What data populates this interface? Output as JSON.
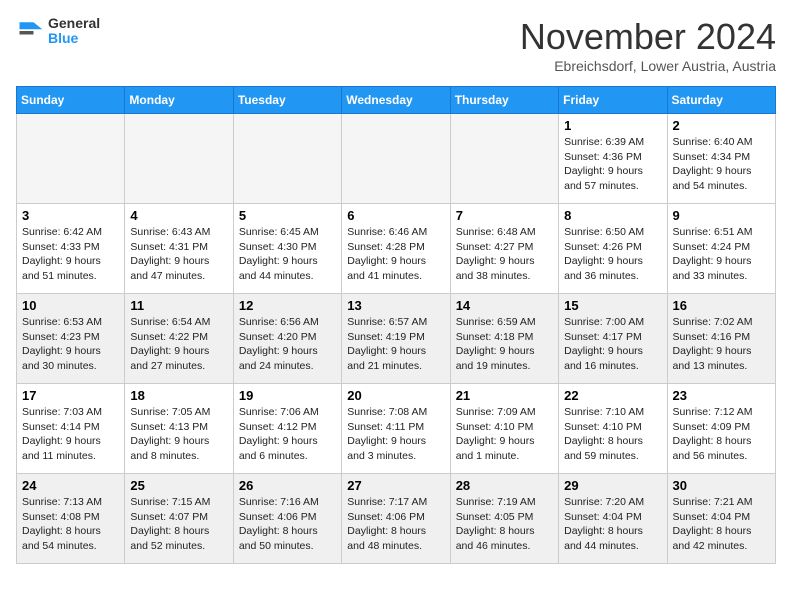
{
  "logo": {
    "line1": "General",
    "line2": "Blue"
  },
  "title": "November 2024",
  "subtitle": "Ebreichsdorf, Lower Austria, Austria",
  "weekdays": [
    "Sunday",
    "Monday",
    "Tuesday",
    "Wednesday",
    "Thursday",
    "Friday",
    "Saturday"
  ],
  "weeks": [
    [
      {
        "day": "",
        "empty": true
      },
      {
        "day": "",
        "empty": true
      },
      {
        "day": "",
        "empty": true
      },
      {
        "day": "",
        "empty": true
      },
      {
        "day": "",
        "empty": true
      },
      {
        "day": "1",
        "sunrise": "6:39 AM",
        "sunset": "4:36 PM",
        "daylight": "9 hours and 57 minutes."
      },
      {
        "day": "2",
        "sunrise": "6:40 AM",
        "sunset": "4:34 PM",
        "daylight": "9 hours and 54 minutes."
      }
    ],
    [
      {
        "day": "3",
        "sunrise": "6:42 AM",
        "sunset": "4:33 PM",
        "daylight": "9 hours and 51 minutes."
      },
      {
        "day": "4",
        "sunrise": "6:43 AM",
        "sunset": "4:31 PM",
        "daylight": "9 hours and 47 minutes."
      },
      {
        "day": "5",
        "sunrise": "6:45 AM",
        "sunset": "4:30 PM",
        "daylight": "9 hours and 44 minutes."
      },
      {
        "day": "6",
        "sunrise": "6:46 AM",
        "sunset": "4:28 PM",
        "daylight": "9 hours and 41 minutes."
      },
      {
        "day": "7",
        "sunrise": "6:48 AM",
        "sunset": "4:27 PM",
        "daylight": "9 hours and 38 minutes."
      },
      {
        "day": "8",
        "sunrise": "6:50 AM",
        "sunset": "4:26 PM",
        "daylight": "9 hours and 36 minutes."
      },
      {
        "day": "9",
        "sunrise": "6:51 AM",
        "sunset": "4:24 PM",
        "daylight": "9 hours and 33 minutes."
      }
    ],
    [
      {
        "day": "10",
        "sunrise": "6:53 AM",
        "sunset": "4:23 PM",
        "daylight": "9 hours and 30 minutes."
      },
      {
        "day": "11",
        "sunrise": "6:54 AM",
        "sunset": "4:22 PM",
        "daylight": "9 hours and 27 minutes."
      },
      {
        "day": "12",
        "sunrise": "6:56 AM",
        "sunset": "4:20 PM",
        "daylight": "9 hours and 24 minutes."
      },
      {
        "day": "13",
        "sunrise": "6:57 AM",
        "sunset": "4:19 PM",
        "daylight": "9 hours and 21 minutes."
      },
      {
        "day": "14",
        "sunrise": "6:59 AM",
        "sunset": "4:18 PM",
        "daylight": "9 hours and 19 minutes."
      },
      {
        "day": "15",
        "sunrise": "7:00 AM",
        "sunset": "4:17 PM",
        "daylight": "9 hours and 16 minutes."
      },
      {
        "day": "16",
        "sunrise": "7:02 AM",
        "sunset": "4:16 PM",
        "daylight": "9 hours and 13 minutes."
      }
    ],
    [
      {
        "day": "17",
        "sunrise": "7:03 AM",
        "sunset": "4:14 PM",
        "daylight": "9 hours and 11 minutes."
      },
      {
        "day": "18",
        "sunrise": "7:05 AM",
        "sunset": "4:13 PM",
        "daylight": "9 hours and 8 minutes."
      },
      {
        "day": "19",
        "sunrise": "7:06 AM",
        "sunset": "4:12 PM",
        "daylight": "9 hours and 6 minutes."
      },
      {
        "day": "20",
        "sunrise": "7:08 AM",
        "sunset": "4:11 PM",
        "daylight": "9 hours and 3 minutes."
      },
      {
        "day": "21",
        "sunrise": "7:09 AM",
        "sunset": "4:10 PM",
        "daylight": "9 hours and 1 minute."
      },
      {
        "day": "22",
        "sunrise": "7:10 AM",
        "sunset": "4:10 PM",
        "daylight": "8 hours and 59 minutes."
      },
      {
        "day": "23",
        "sunrise": "7:12 AM",
        "sunset": "4:09 PM",
        "daylight": "8 hours and 56 minutes."
      }
    ],
    [
      {
        "day": "24",
        "sunrise": "7:13 AM",
        "sunset": "4:08 PM",
        "daylight": "8 hours and 54 minutes."
      },
      {
        "day": "25",
        "sunrise": "7:15 AM",
        "sunset": "4:07 PM",
        "daylight": "8 hours and 52 minutes."
      },
      {
        "day": "26",
        "sunrise": "7:16 AM",
        "sunset": "4:06 PM",
        "daylight": "8 hours and 50 minutes."
      },
      {
        "day": "27",
        "sunrise": "7:17 AM",
        "sunset": "4:06 PM",
        "daylight": "8 hours and 48 minutes."
      },
      {
        "day": "28",
        "sunrise": "7:19 AM",
        "sunset": "4:05 PM",
        "daylight": "8 hours and 46 minutes."
      },
      {
        "day": "29",
        "sunrise": "7:20 AM",
        "sunset": "4:04 PM",
        "daylight": "8 hours and 44 minutes."
      },
      {
        "day": "30",
        "sunrise": "7:21 AM",
        "sunset": "4:04 PM",
        "daylight": "8 hours and 42 minutes."
      }
    ]
  ]
}
